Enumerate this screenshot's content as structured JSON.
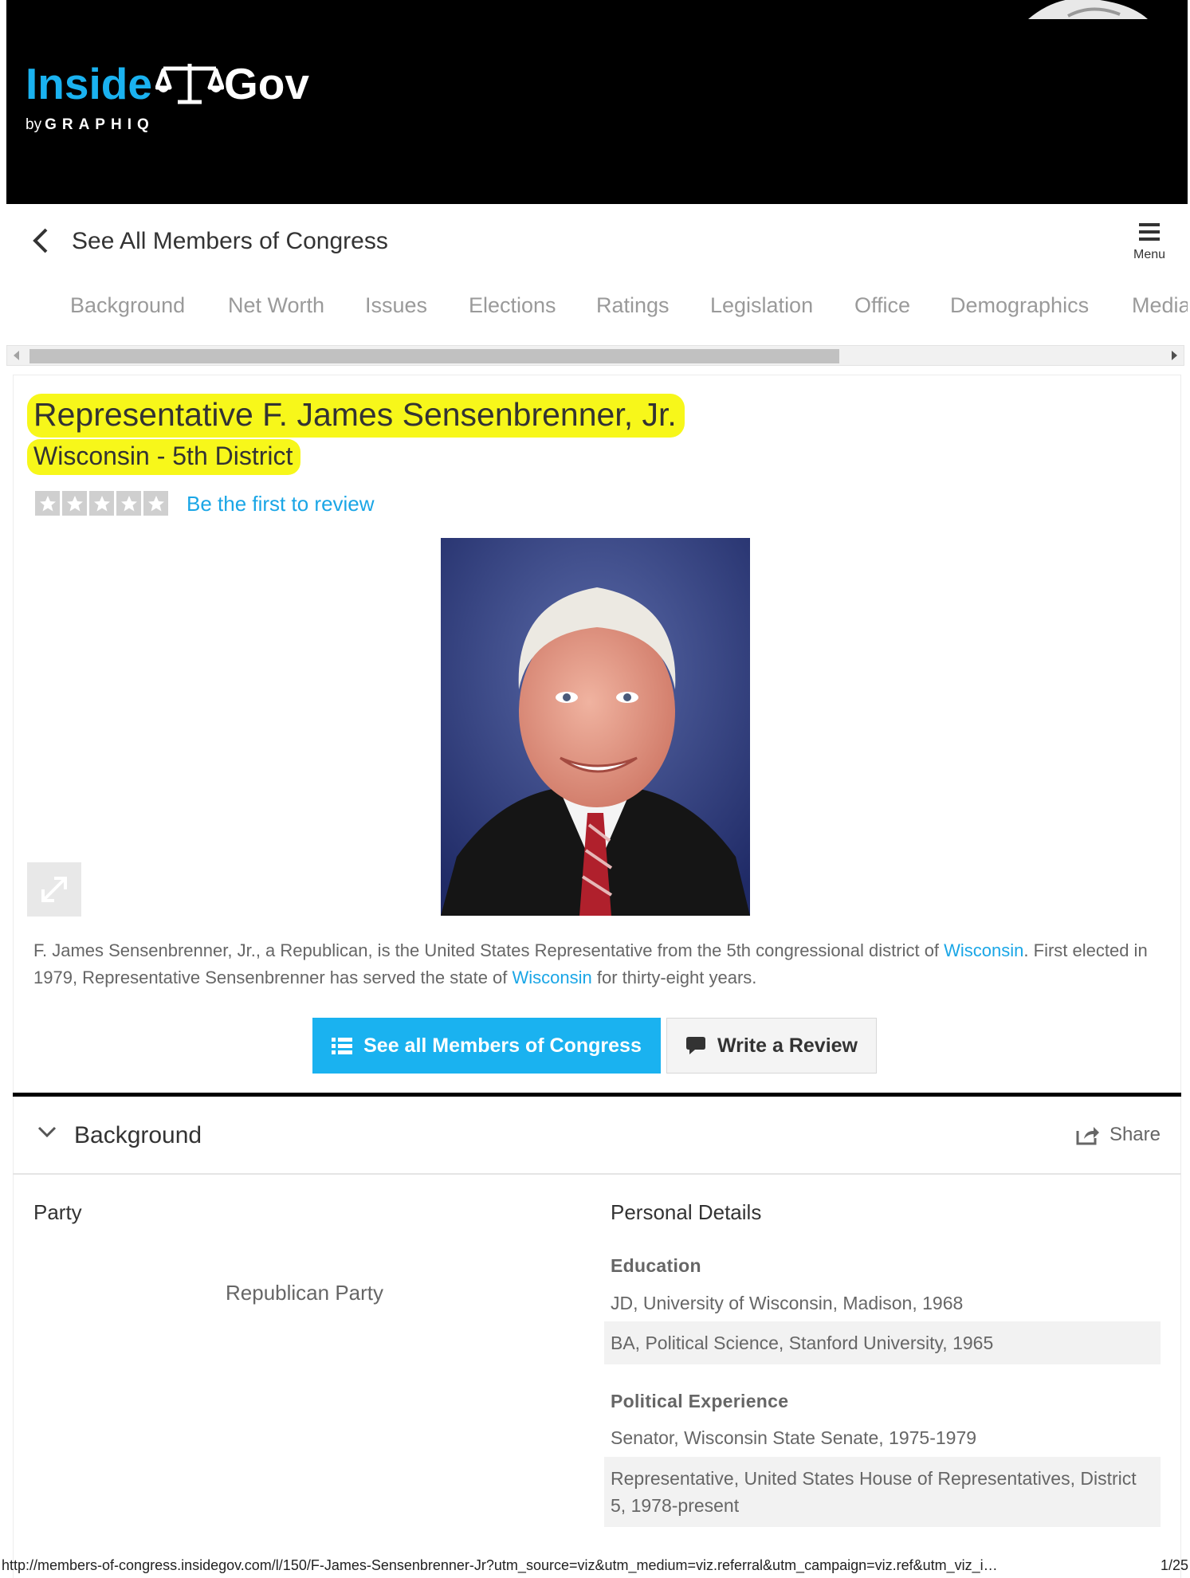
{
  "header": {
    "logo_inside": "Inside",
    "logo_gov": "Gov",
    "by": "by",
    "brand": "GRAPHIQ"
  },
  "nav": {
    "back_label": "See All Members of Congress",
    "menu_label": "Menu",
    "tabs": [
      "Background",
      "Net Worth",
      "Issues",
      "Elections",
      "Ratings",
      "Legislation",
      "Office",
      "Demographics",
      "Media"
    ]
  },
  "profile": {
    "title": "Representative F. James Sensenbrenner, Jr.",
    "district": "Wisconsin - 5th District",
    "rating_stars": 0,
    "review_link": "Be the first to review",
    "bio_part1": "F. James Sensenbrenner, Jr., a Republican, is the United States Representative from the 5th congressional district of ",
    "bio_link1": "Wisconsin",
    "bio_part2": ". First elected in 1979, Representative Sensenbrenner has served the state of ",
    "bio_link2": "Wisconsin",
    "bio_part3": " for thirty-eight years."
  },
  "actions": {
    "see_all_label": "See all Members of Congress",
    "write_review_label": "Write a Review"
  },
  "background": {
    "section_title": "Background",
    "share_label": "Share",
    "party_label": "Party",
    "party_value": "Republican Party",
    "personal_details_label": "Personal Details",
    "education_label": "Education",
    "education": [
      "JD, University of Wisconsin, Madison, 1968",
      "BA, Political Science, Stanford University, 1965"
    ],
    "political_label": "Political Experience",
    "political": [
      "Senator, Wisconsin State Senate, 1975-1979",
      "Representative, United States House of Representatives, District 5, 1978-present"
    ]
  },
  "footer": {
    "url": "http://members-of-congress.insidegov.com/l/150/F-James-Sensenbrenner-Jr?utm_source=viz&utm_medium=viz.referral&utm_campaign=viz.ref&utm_viz_i…",
    "page": "1/25"
  },
  "colors": {
    "accent": "#1ab2f0",
    "link": "#1aa6e6",
    "highlight": "#f7f71a",
    "header_bg": "#000000"
  }
}
